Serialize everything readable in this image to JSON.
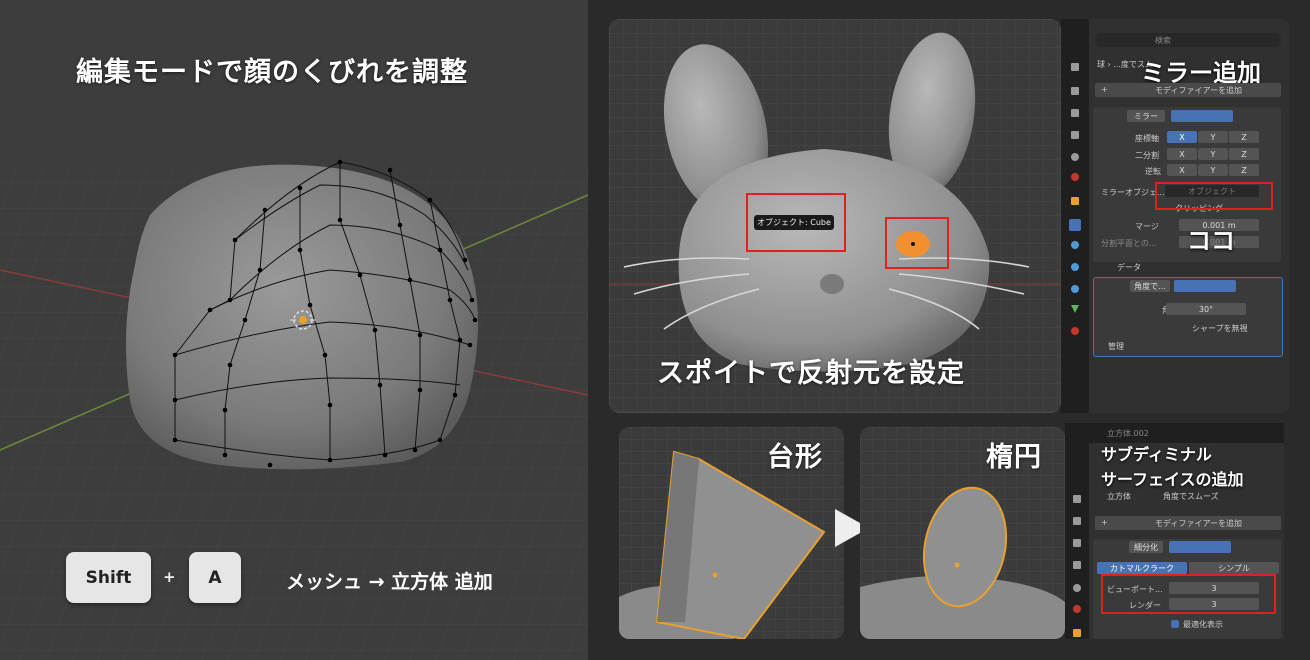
{
  "left": {
    "title": "編集モードで顔のくびれを調整",
    "key1": "Shift",
    "plus": "+",
    "key2": "A",
    "command": "メッシュ → 立方体 追加"
  },
  "mirror_section": {
    "heading": "ミラー追加",
    "eyedropper_caption": "スポイトで反射元を設定",
    "tooltip": "オブジェクト: Cube",
    "here_label": "ココ",
    "search_placeholder": "検索",
    "breadcrumb": "球 › ...度でスム...",
    "add_modifier": "モディファイアーを追加",
    "mirror_modifier": {
      "name": "ミラー",
      "axis_label": "座標軸",
      "bisect_label": "二分割",
      "flip_label": "逆転",
      "axes": [
        "X",
        "Y",
        "Z"
      ],
      "mirror_object_label": "ミラーオブジェ...",
      "mirror_object_placeholder": "オブジェクト",
      "clipping_label": "クリッピング",
      "merge_label": "マージ",
      "merge_value": "0.001 m",
      "bisect_distance_label": "分割平面との...",
      "bisect_distance_value": "0.001 m",
      "data_label": "データ"
    },
    "smooth_modifier": {
      "name": "角度で...",
      "angle_label": "角度",
      "angle_value": "30°",
      "sharp_label": "シャープを無視",
      "manage_label": "管理"
    }
  },
  "bottom_section": {
    "trapezoid_label": "台形",
    "ellipse_label": "楕円",
    "subsurf_heading_line1": "サブディミナル",
    "subsurf_heading_line2": "サーフェイスの追加",
    "outliner_item": "立方体.002",
    "breadcrumb_object": "立方体",
    "breadcrumb_modifier": "角度でスムーズ",
    "add_modifier": "モディファイアーを追加",
    "subsurf_modifier": {
      "name": "細分化",
      "tab_catmull": "カトマルクラーク",
      "tab_simple": "シンプル",
      "viewport_label": "ビューポート...",
      "viewport_value": "3",
      "render_label": "レンダー",
      "render_value": "3",
      "optimal_label": "最適化表示"
    }
  },
  "colors": {
    "highlight": "#e02020",
    "accent": "#4772b3",
    "selection": "#e8a030",
    "background": "#3d3d3d"
  }
}
